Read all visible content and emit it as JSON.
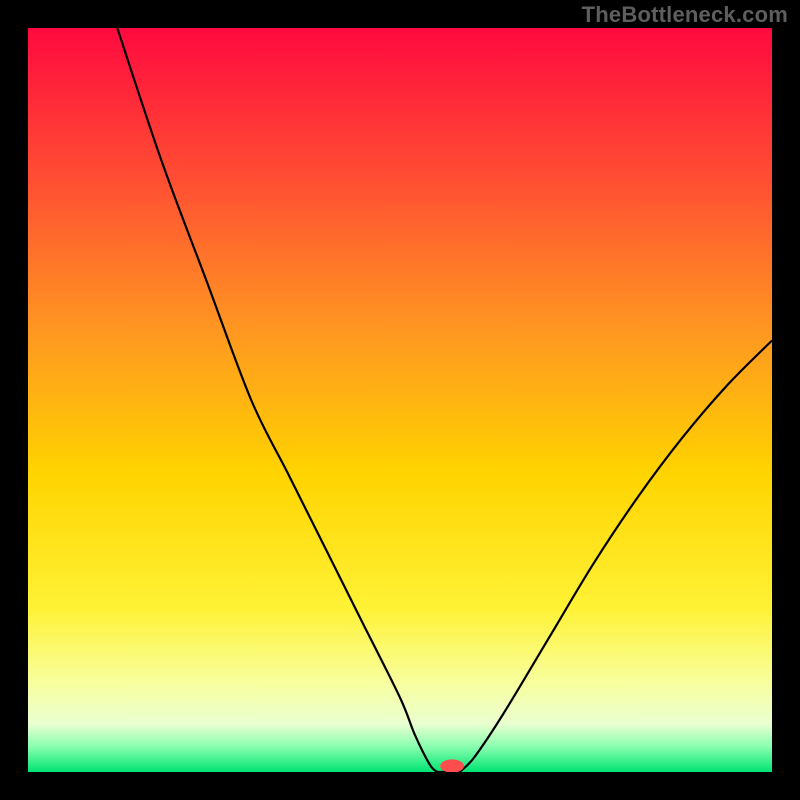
{
  "watermark": "TheBottleneck.com",
  "chart_data": {
    "type": "line",
    "title": "",
    "xlabel": "",
    "ylabel": "",
    "xlim": [
      0,
      100
    ],
    "ylim": [
      0,
      100
    ],
    "grid": false,
    "legend": false,
    "gradient_colors": [
      {
        "offset": 0.0,
        "hex": "#ff0a3f"
      },
      {
        "offset": 0.2,
        "hex": "#ff4d33"
      },
      {
        "offset": 0.4,
        "hex": "#ff9522"
      },
      {
        "offset": 0.6,
        "hex": "#ffd400"
      },
      {
        "offset": 0.78,
        "hex": "#fff236"
      },
      {
        "offset": 0.88,
        "hex": "#f8ff9e"
      },
      {
        "offset": 0.935,
        "hex": "#eaffd0"
      },
      {
        "offset": 0.965,
        "hex": "#8cffb0"
      },
      {
        "offset": 1.0,
        "hex": "#00e472"
      }
    ],
    "series": [
      {
        "name": "bottleneck-curve-left",
        "stroke": "#000000",
        "x": [
          12,
          18,
          24,
          30,
          35,
          40,
          45,
          50,
          52,
          54,
          55
        ],
        "y": [
          100,
          82,
          66,
          50,
          40,
          30,
          20,
          10,
          5,
          1,
          0
        ]
      },
      {
        "name": "bottleneck-curve-right",
        "stroke": "#000000",
        "x": [
          58,
          60,
          64,
          70,
          76,
          82,
          88,
          94,
          100
        ],
        "y": [
          0,
          2,
          8,
          18,
          28,
          37,
          45,
          52,
          58
        ]
      }
    ],
    "flat_segment": {
      "x0": 55,
      "x1": 58,
      "y": 0
    },
    "marker": {
      "x": 57,
      "y": 0.8,
      "rx": 1.6,
      "ry": 0.9,
      "fill": "#ff4d4d"
    }
  }
}
